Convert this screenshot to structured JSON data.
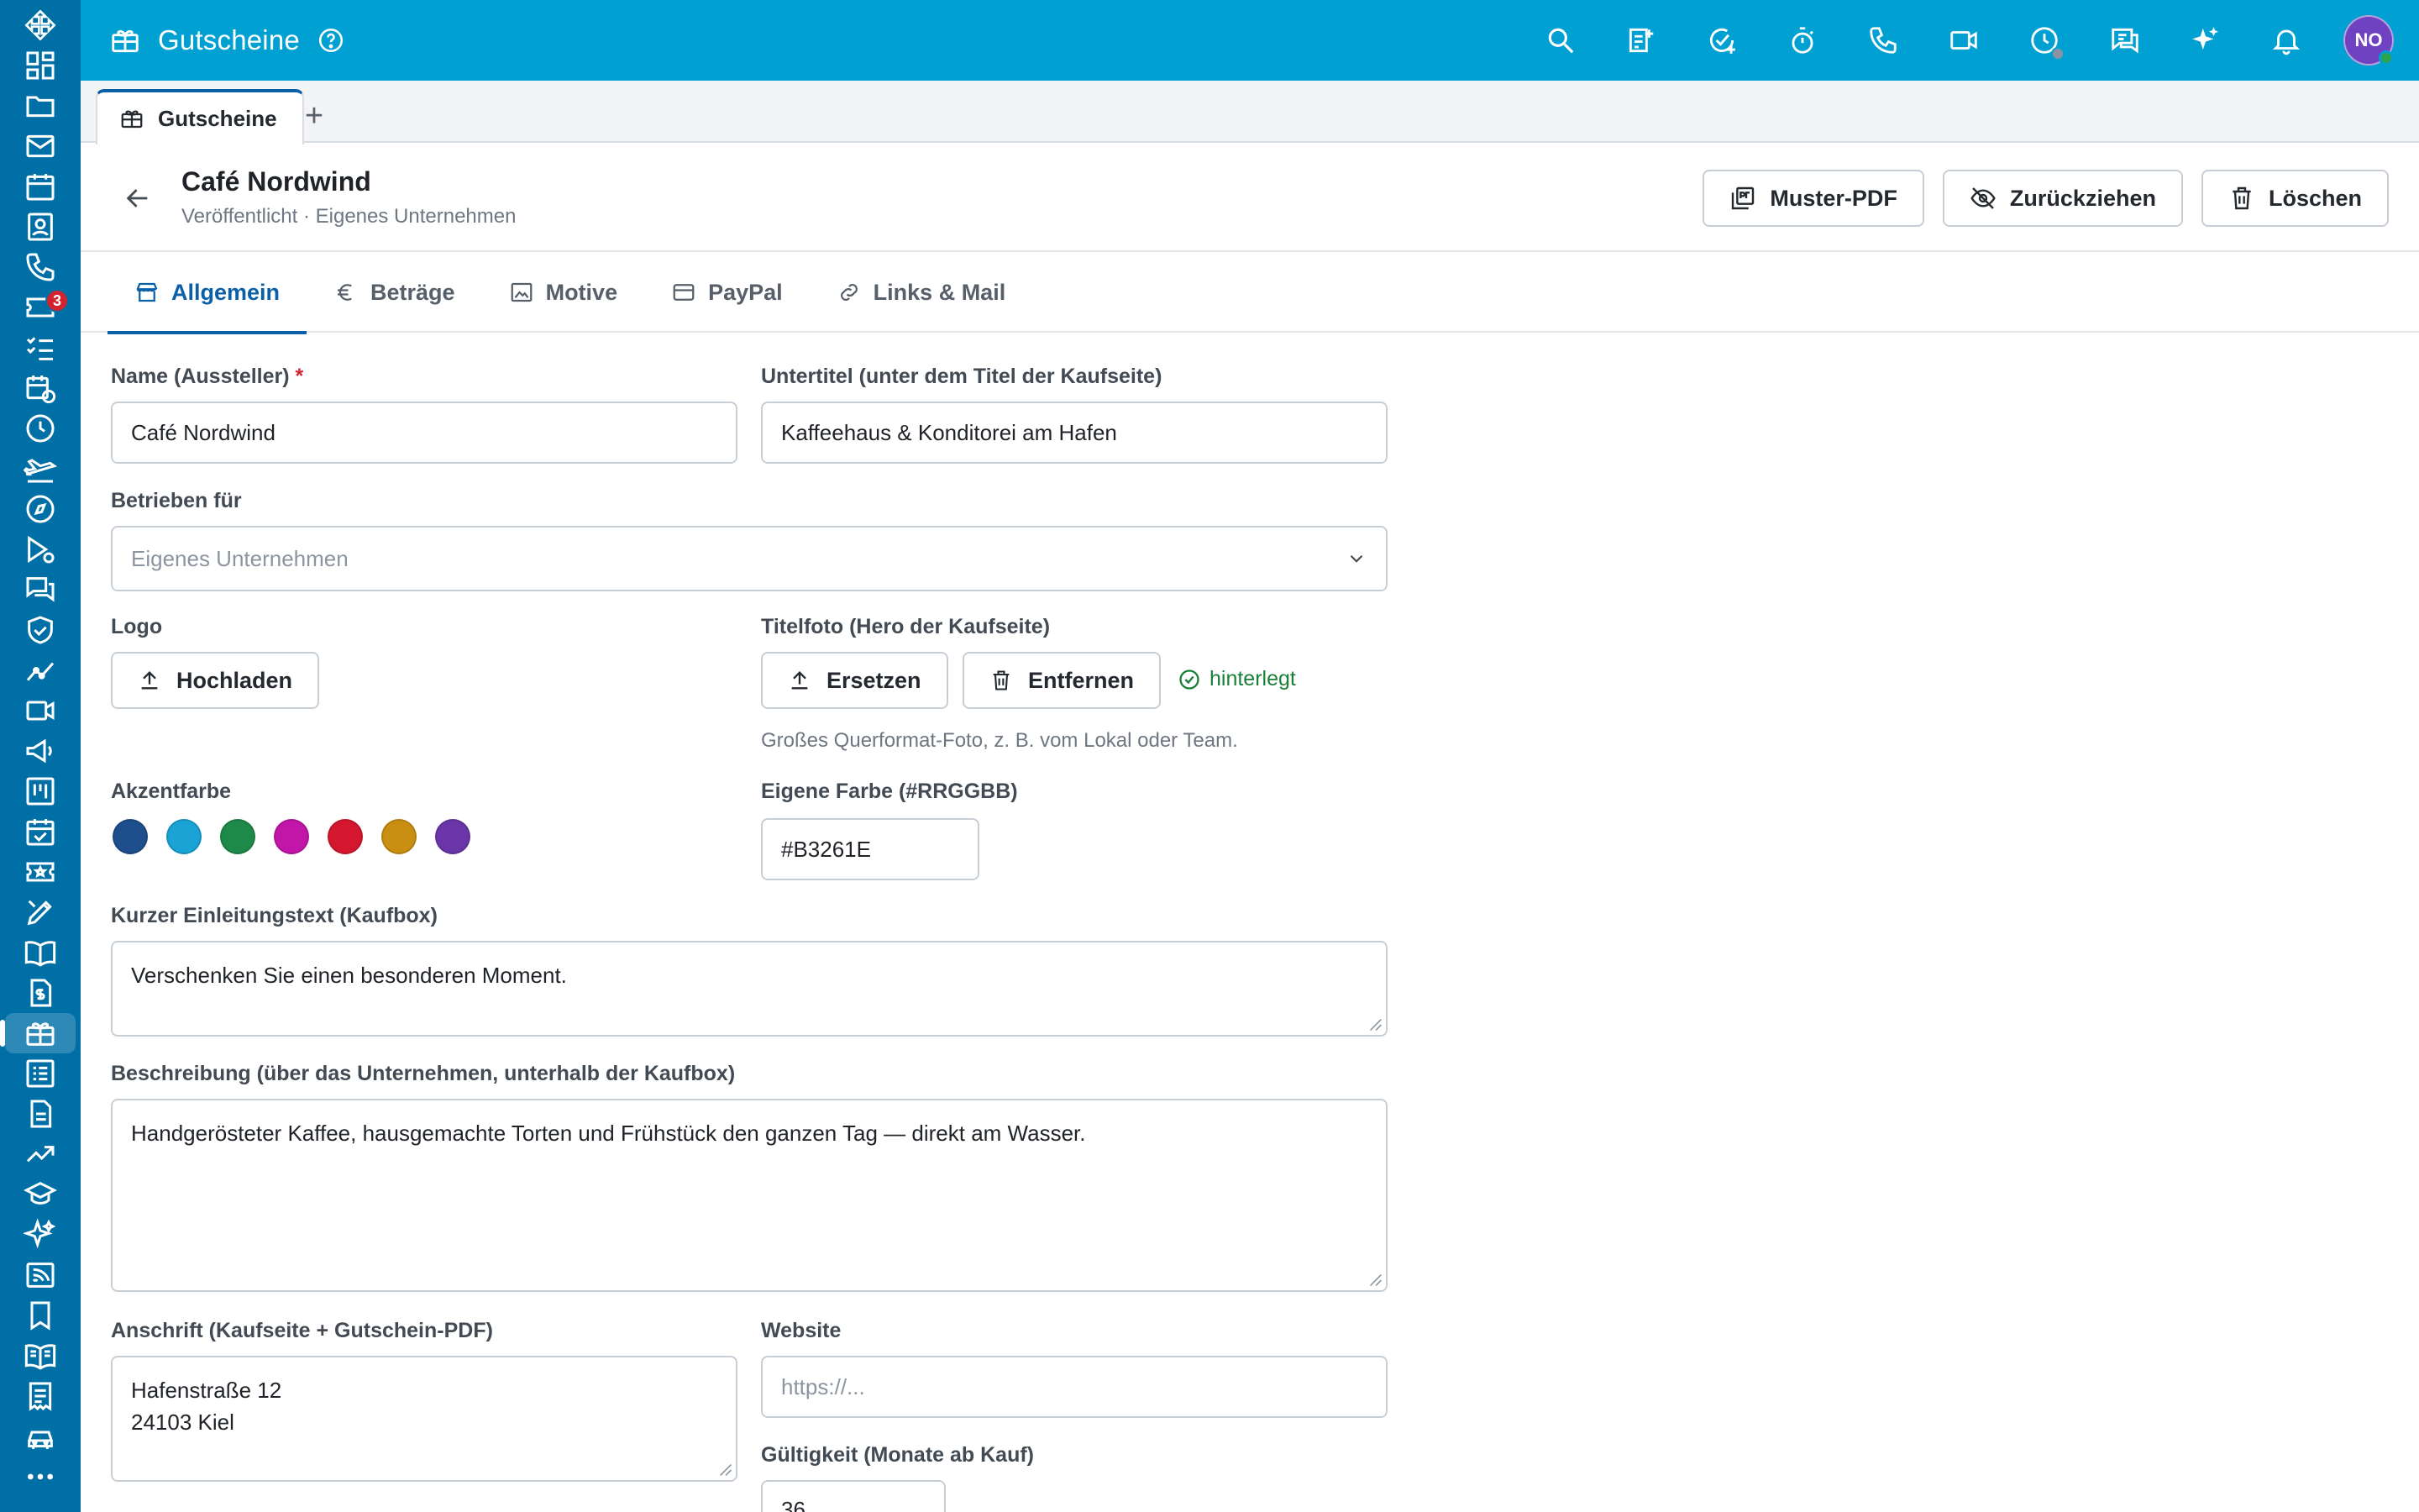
{
  "app": {
    "title": "Gutscheine",
    "avatar_initials": "NO"
  },
  "rail": {
    "icons": [
      "apps-arrows-icon",
      "dashboard-icon",
      "folder-icon",
      "mail-icon",
      "calendar-icon",
      "contacts-icon",
      "phone-icon",
      "tickets-icon",
      "tasks-icon",
      "schedule-icon",
      "clock-icon",
      "travel-icon",
      "compass-icon",
      "dispatch-icon",
      "chat-icon",
      "shield-icon",
      "analytics-icon",
      "video-icon",
      "megaphone-icon",
      "kanban-icon",
      "calendar-check-icon",
      "ticket-star-icon",
      "edit-icon",
      "book-icon",
      "invoice-icon",
      "gift-card-icon",
      "list-icon",
      "document-icon",
      "trending-icon",
      "school-icon",
      "sparkles-icon",
      "feed-icon",
      "bookmark-icon",
      "manual-icon",
      "receipt-icon",
      "car-icon",
      "more-icon"
    ],
    "badge": "3"
  },
  "topbar": {
    "icons": [
      "search-icon",
      "note-add-icon",
      "task-add-icon",
      "timer-icon",
      "phone-icon",
      "video-icon",
      "presence-clock-icon",
      "chat-icon",
      "ai-sparkles-icon",
      "bell-icon"
    ]
  },
  "tabs": {
    "doc_tab": "Gutscheine",
    "add": "+"
  },
  "record": {
    "title": "Café Nordwind",
    "subtitle": "Veröffentlicht · Eigenes Unternehmen",
    "actions": {
      "pdf": "Muster-PDF",
      "withdraw": "Zurückziehen",
      "delete": "Löschen"
    }
  },
  "section_tabs": {
    "general": "Allgemein",
    "amounts": "Beträge",
    "motifs": "Motive",
    "paypal": "PayPal",
    "links": "Links & Mail"
  },
  "form": {
    "name_label": "Name (Aussteller)",
    "required_mark": "*",
    "name_value": "Café Nordwind",
    "subtitle_label": "Untertitel (unter dem Titel der Kaufseite)",
    "subtitle_value": "Kaffeehaus & Konditorei am Hafen",
    "operated_label": "Betrieben für",
    "operated_value": "Eigenes Unternehmen",
    "logo_label": "Logo",
    "logo_upload": "Hochladen",
    "hero_label": "Titelfoto (Hero der Kaufseite)",
    "hero_replace": "Ersetzen",
    "hero_remove": "Entfernen",
    "hero_status": "hinterlegt",
    "hero_help": "Großes Querformat-Foto, z. B. vom Lokal oder Team.",
    "accent_label": "Akzentfarbe",
    "accent_colors": [
      "#1f4e8c",
      "#1aa3d4",
      "#1e8a4a",
      "#c116a8",
      "#d4172e",
      "#c98f13",
      "#6a35a8"
    ],
    "custom_color_label": "Eigene Farbe (#RRGGBB)",
    "custom_color_value": "#B3261E",
    "intro_label": "Kurzer Einleitungstext (Kaufbox)",
    "intro_value": "Verschenken Sie einen besonderen Moment.",
    "desc_label": "Beschreibung (über das Unternehmen, unterhalb der Kaufbox)",
    "desc_value": "Handgerösteter Kaffee, hausgemachte Torten und Frühstück den ganzen Tag — direkt am Wasser.",
    "address_label": "Anschrift (Kaufseite + Gutschein-PDF)",
    "address_line1": "Hafenstraße 12",
    "address_line2": "24103 Kiel",
    "website_label": "Website",
    "website_placeholder": "https://...",
    "validity_label": "Gültigkeit (Monate ab Kauf)",
    "validity_value": "36"
  }
}
